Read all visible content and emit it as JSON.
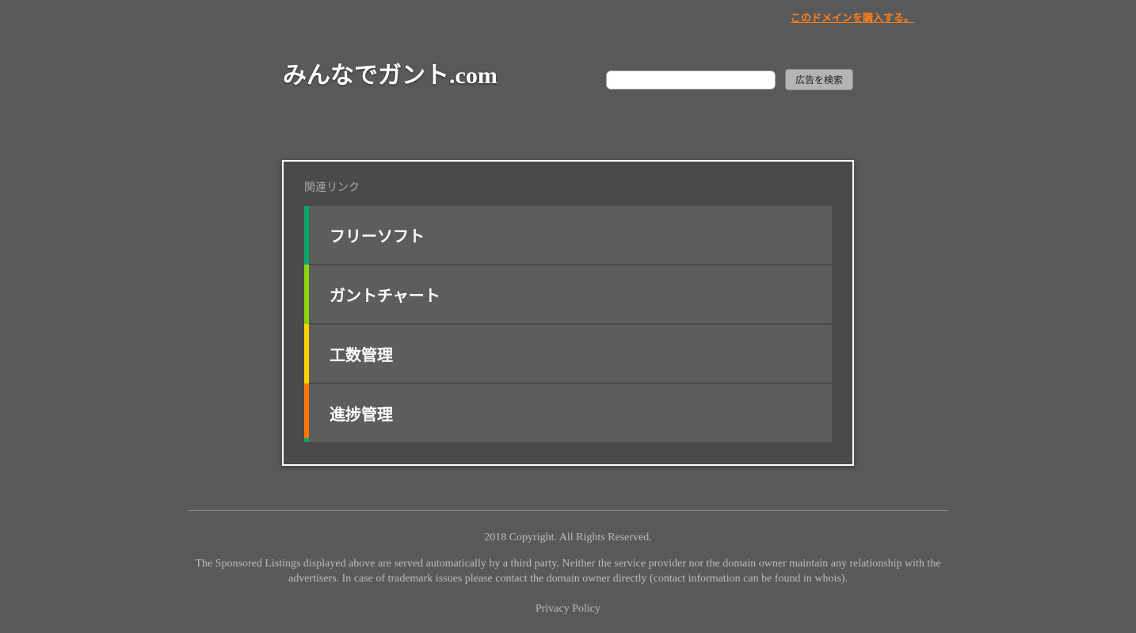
{
  "top_link": "このドメインを購入する。",
  "domain_title": "みんなでガント.com",
  "search": {
    "value": "",
    "button_label": "広告を検索"
  },
  "card": {
    "heading": "関連リンク",
    "links": [
      "フリーソフト",
      "ガントチャート",
      "工数管理",
      "進捗管理"
    ]
  },
  "footer": {
    "copyright": "2018 Copyright. All Rights Reserved.",
    "disclaimer": "The Sponsored Listings displayed above are served automatically by a third party. Neither the service provider nor the domain owner maintain any relationship with the advertisers. In case of trademark issues please contact the domain owner directly (contact information can be found in whois).",
    "privacy": "Privacy Policy"
  }
}
